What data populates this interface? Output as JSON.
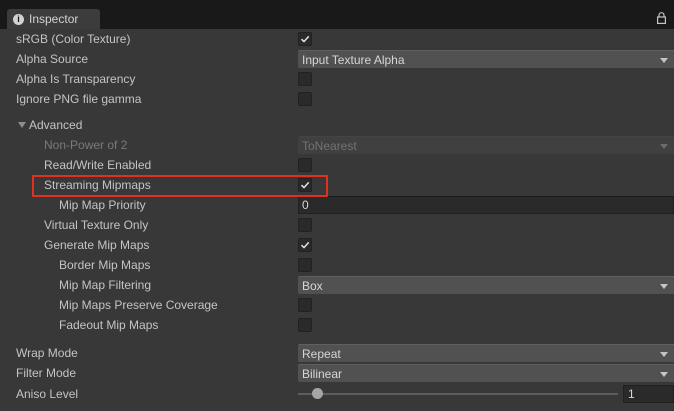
{
  "tab": {
    "title": "Inspector",
    "icon": "info-icon"
  },
  "rows": {
    "srgb": {
      "label": "sRGB (Color Texture)",
      "checked": true
    },
    "alpha_source": {
      "label": "Alpha Source",
      "value": "Input Texture Alpha"
    },
    "alpha_transparency": {
      "label": "Alpha Is Transparency",
      "checked": false
    },
    "ignore_png_gamma": {
      "label": "Ignore PNG file gamma",
      "checked": false
    },
    "advanced": {
      "label": "Advanced",
      "expanded": true
    },
    "non_power_of_2": {
      "label": "Non-Power of 2",
      "value": "ToNearest",
      "disabled": true
    },
    "read_write": {
      "label": "Read/Write Enabled",
      "checked": false
    },
    "streaming_mipmaps": {
      "label": "Streaming Mipmaps",
      "checked": true
    },
    "mip_map_priority": {
      "label": "Mip Map Priority",
      "value": "0"
    },
    "virtual_texture_only": {
      "label": "Virtual Texture Only",
      "checked": false
    },
    "generate_mip_maps": {
      "label": "Generate Mip Maps",
      "checked": true
    },
    "border_mip_maps": {
      "label": "Border Mip Maps",
      "checked": false
    },
    "mip_map_filtering": {
      "label": "Mip Map Filtering",
      "value": "Box"
    },
    "mip_maps_preserve_coverage": {
      "label": "Mip Maps Preserve Coverage",
      "checked": false
    },
    "fadeout_mip_maps": {
      "label": "Fadeout Mip Maps",
      "checked": false
    },
    "wrap_mode": {
      "label": "Wrap Mode",
      "value": "Repeat"
    },
    "filter_mode": {
      "label": "Filter Mode",
      "value": "Bilinear"
    },
    "aniso_level": {
      "label": "Aniso Level",
      "value": "1",
      "fraction": 0.06
    }
  },
  "colors": {
    "highlight": "#e0301e",
    "panel": "#383838",
    "tabbar": "#191919"
  }
}
